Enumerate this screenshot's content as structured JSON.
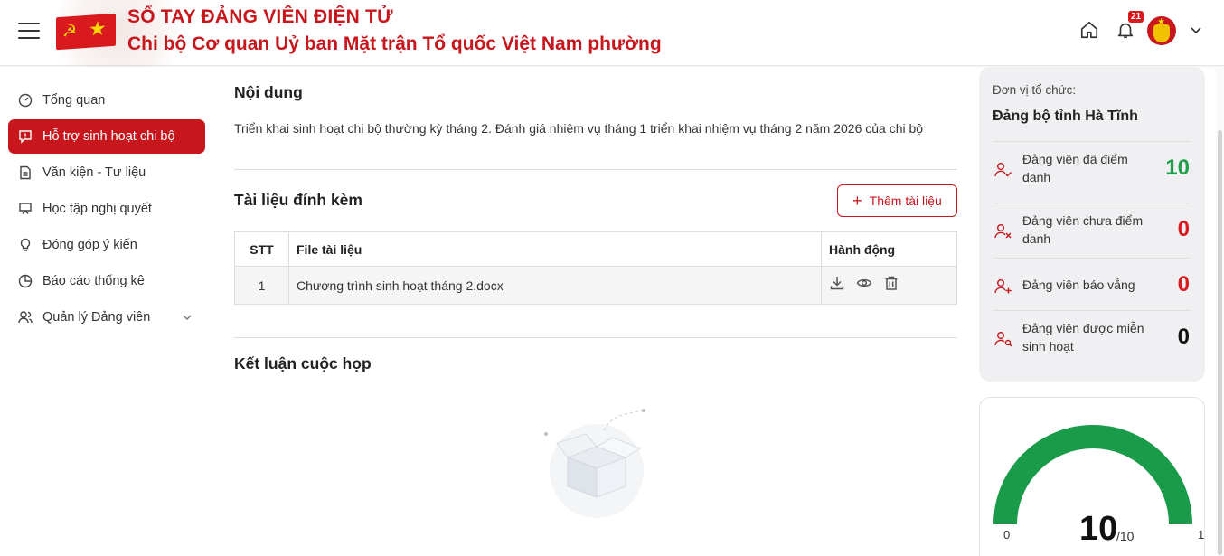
{
  "header": {
    "title_line1": "SỔ TAY ĐẢNG VIÊN ĐIỆN TỬ",
    "title_line2": "Chi bộ Cơ quan Uỷ ban Mặt trận Tổ quốc Việt Nam phường",
    "notification_count": "21",
    "brand_color": "#c8161d"
  },
  "sidebar": {
    "items": [
      {
        "label": "Tổng quan",
        "icon": "dashboard-icon"
      },
      {
        "label": "Hỗ trợ sinh hoạt chi bộ",
        "icon": "chat-alert-icon",
        "active": true
      },
      {
        "label": "Văn kiện - Tư liệu",
        "icon": "document-icon"
      },
      {
        "label": "Học tập nghị quyết",
        "icon": "presentation-icon"
      },
      {
        "label": "Đóng góp ý kiến",
        "icon": "lightbulb-icon"
      },
      {
        "label": "Báo cáo thống kê",
        "icon": "pie-chart-icon"
      },
      {
        "label": "Quản lý Đảng viên",
        "icon": "users-icon"
      }
    ]
  },
  "main": {
    "content_title": "Nội dung",
    "content_text": "Triển khai sinh hoạt chi bộ thường kỳ tháng 2. Đánh giá nhiệm vụ tháng 1 triển khai nhiệm vụ tháng 2 năm 2026 của chi bộ",
    "attachments_title": "Tài liệu đính kèm",
    "add_button": "Thêm tài liệu",
    "table": {
      "headers": [
        "STT",
        "File tài liệu",
        "Hành động"
      ],
      "rows": [
        {
          "stt": "1",
          "file": "Chương trình sinh hoạt tháng 2.docx"
        }
      ]
    },
    "conclusion_title": "Kết luận cuộc họp"
  },
  "stats": {
    "org_label": "Đơn vị tổ chức:",
    "org_name": "Đảng bộ tỉnh Hà Tĩnh",
    "rows": [
      {
        "label": "Đảng viên đã điểm danh",
        "value": "10",
        "color": "#1e9e4a",
        "icon": "user-check-icon"
      },
      {
        "label": "Đảng viên chưa điểm danh",
        "value": "0",
        "color": "#d8191d",
        "icon": "user-x-icon"
      },
      {
        "label": "Đảng viên báo vắng",
        "value": "0",
        "color": "#d8191d",
        "icon": "user-plus-icon"
      },
      {
        "label": "Đảng viên được miễn sinh hoạt",
        "value": "0",
        "color": "#111111",
        "icon": "user-search-icon"
      }
    ],
    "gauge": {
      "min": "0",
      "max": "10",
      "value": "10",
      "of": "/10",
      "fraction": 1.0,
      "color": "#1a9b49"
    }
  }
}
